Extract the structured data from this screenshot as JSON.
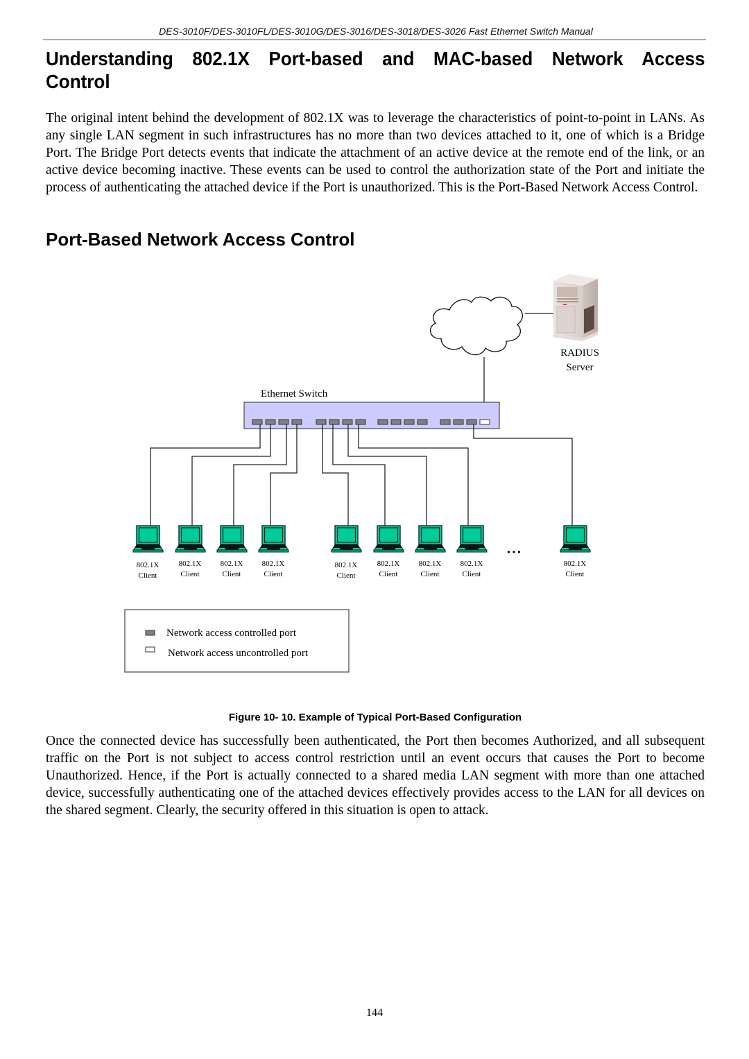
{
  "header": {
    "running_title": "DES-3010F/DES-3010FL/DES-3010G/DES-3016/DES-3018/DES-3026 Fast Ethernet Switch Manual"
  },
  "section": {
    "title_line1": "Understanding 802.1X Port-based and MAC-based Network Access",
    "title_line2": "Control",
    "paragraph1": "The original intent behind the development of 802.1X was to leverage the characteristics of point-to-point in LANs. As any single LAN segment in such infrastructures has no more than two devices attached to it, one of which is a Bridge Port. The Bridge Port detects events that indicate the attachment of an active device at the remote end of the link, or an active device becoming inactive. These events can be used to control the authorization state of the Port and initiate the process of authenticating the attached device if the Port is unauthorized. This is the Port-Based Network Access Control."
  },
  "subsection": {
    "title": "Port-Based Network Access Control"
  },
  "diagram": {
    "radius_label_line1": "RADIUS",
    "radius_label_line2": "Server",
    "switch_label": "Ethernet Switch",
    "ellipsis": "• • •",
    "switch_ports": {
      "groups": 4,
      "ports_per_group": 4,
      "uncontrolled_port_index": 15
    },
    "clients": [
      {
        "line1": "802.1X",
        "line2": "Client"
      },
      {
        "line1": "802.1X",
        "line2": "Client"
      },
      {
        "line1": "802.1X",
        "line2": "Client"
      },
      {
        "line1": "802.1X",
        "line2": "Client"
      },
      {
        "line1": "802.1X",
        "line2": "Client"
      },
      {
        "line1": "802.1X",
        "line2": "Client"
      },
      {
        "line1": "802.1X",
        "line2": "Client"
      },
      {
        "line1": "802.1X",
        "line2": "Client"
      },
      {
        "line1": "802.1X",
        "line2": "Client"
      }
    ],
    "legend": {
      "controlled": "Network access controlled port",
      "uncontrolled": "Network access uncontrolled port"
    },
    "colors": {
      "switch_fill": "#ccccff",
      "port_controlled": "#808080",
      "port_uncontrolled": "#ffffff",
      "laptop_screen": "#00cc99"
    }
  },
  "figure": {
    "caption": "Figure 10- 10. Example of Typical Port-Based Configuration"
  },
  "paragraph2": "Once the connected device has successfully been authenticated, the Port then becomes Authorized, and all subsequent traffic on the Port is not subject to access control restriction until an event occurs that causes the Port to become Unauthorized. Hence, if the Port is actually connected to a shared media LAN segment with more than one attached device, successfully authenticating one of the attached devices effectively provides access to the LAN for all devices on the shared segment. Clearly, the security offered in this situation is open to attack.",
  "page_number": "144"
}
